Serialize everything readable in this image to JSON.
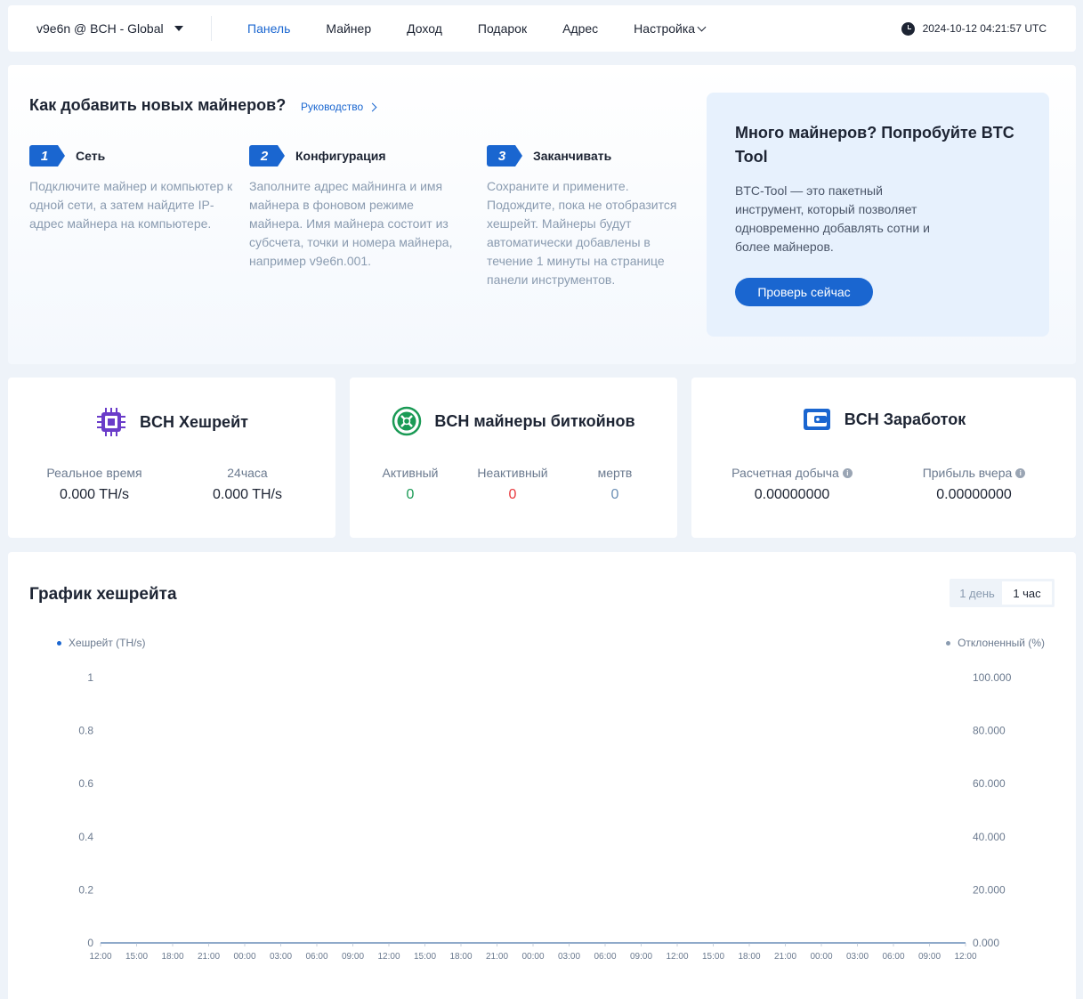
{
  "header": {
    "account": "v9e6n @ BCH - Global",
    "nav": [
      {
        "label": "Панель",
        "active": true
      },
      {
        "label": "Майнер"
      },
      {
        "label": "Доход"
      },
      {
        "label": "Подарок"
      },
      {
        "label": "Адрес"
      },
      {
        "label": "Настройка"
      }
    ],
    "datetime": "2024-10-12 04:21:57 UTC"
  },
  "guide": {
    "title": "Как добавить новых майнеров?",
    "link": "Руководство",
    "steps": [
      {
        "num": "1",
        "label": "Сеть",
        "text": "Подключите майнер и компьютер к одной сети, а затем найдите IP-адрес майнера на компьютере."
      },
      {
        "num": "2",
        "label": "Конфигурация",
        "text": "Заполните адрес майнинга и имя майнера в фоновом режиме майнера. Имя майнера состоит из субсчета, точки и номера майнера, например v9e6n.001."
      },
      {
        "num": "3",
        "label": "Заканчивать",
        "text": "Сохраните и примените. Подождите, пока не отобразится хешрейт. Майнеры будут автоматически добавлены в течение 1 минуты на странице панели инструментов."
      }
    ],
    "promo": {
      "title": "Много майнеров? Попробуйте BTC Tool",
      "text": "BTC-Tool — это пакетный инструмент, который позволяет одновременно добавлять сотни и более майнеров.",
      "button": "Проверь сейчас"
    }
  },
  "cards": {
    "hashrate": {
      "title": "BCH Хешрейт",
      "realtime_label": "Реальное время",
      "realtime_value": "0.000 TH/s",
      "day_label": "24часа",
      "day_value": "0.000 TH/s"
    },
    "miners": {
      "title": "BCH майнеры биткойнов",
      "active_label": "Активный",
      "active_value": "0",
      "inactive_label": "Неактивный",
      "inactive_value": "0",
      "dead_label": "мертв",
      "dead_value": "0"
    },
    "earnings": {
      "title": "BCH Заработок",
      "est_label": "Расчетная добыча",
      "est_value": "0.00000000",
      "yest_label": "Прибыль вчера",
      "yest_value": "0.00000000"
    }
  },
  "colors": {
    "accent": "#1a66d0",
    "active": "#1a9a55",
    "inactive": "#e8383d",
    "dead": "#6b8fb5"
  },
  "chart": {
    "title": "График хешрейта",
    "range_options": [
      "1 день",
      "1 час"
    ],
    "selected_range": "1 час",
    "legend_left": "Хешрейт (TH/s)",
    "legend_right": "Отклоненный (%)"
  },
  "chart_data": {
    "type": "line",
    "x": [
      "12:00",
      "15:00",
      "18:00",
      "21:00",
      "00:00",
      "03:00",
      "06:00",
      "09:00",
      "12:00",
      "15:00",
      "18:00",
      "21:00",
      "00:00",
      "03:00",
      "06:00",
      "09:00",
      "12:00",
      "15:00",
      "18:00",
      "21:00",
      "00:00",
      "03:00",
      "06:00",
      "09:00",
      "12:00"
    ],
    "y_left_ticks": [
      "0",
      "0.2",
      "0.4",
      "0.6",
      "0.8",
      "1"
    ],
    "y_right_ticks": [
      "0.000",
      "20.000",
      "40.000",
      "60.000",
      "80.000",
      "100.000"
    ],
    "ylim_left": [
      0,
      1
    ],
    "ylim_right": [
      0,
      100
    ],
    "series": [
      {
        "name": "Хешрейт (TH/s)",
        "axis": "left",
        "values": [
          0,
          0,
          0,
          0,
          0,
          0,
          0,
          0,
          0,
          0,
          0,
          0,
          0,
          0,
          0,
          0,
          0,
          0,
          0,
          0,
          0,
          0,
          0,
          0,
          0
        ]
      },
      {
        "name": "Отклоненный (%)",
        "axis": "right",
        "values": [
          0,
          0,
          0,
          0,
          0,
          0,
          0,
          0,
          0,
          0,
          0,
          0,
          0,
          0,
          0,
          0,
          0,
          0,
          0,
          0,
          0,
          0,
          0,
          0,
          0
        ]
      }
    ],
    "grid": false
  }
}
